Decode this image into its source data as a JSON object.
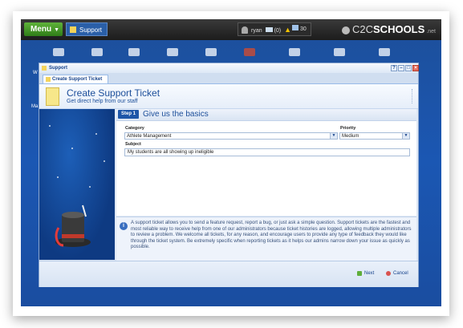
{
  "topbar": {
    "menu_label": "Menu",
    "support_label": "Support",
    "user_name": "ryan",
    "messages_count": "(0)",
    "alerts_count": "30",
    "logo_prefix": "C2C",
    "logo_main": "SCHOOLS",
    "logo_suffix": ".net"
  },
  "desktop": {
    "label_w": "W",
    "label_ma": "Ma"
  },
  "window": {
    "title": "Support",
    "tab_label": "Create Support Ticket",
    "header_title": "Create Support Ticket",
    "header_subtitle": "Get direct help from our staff"
  },
  "step": {
    "badge": "Step 1",
    "title": "Give us the basics"
  },
  "form": {
    "category_label": "Category",
    "category_value": "Athlete Management",
    "priority_label": "Priority",
    "priority_value": "Medium",
    "subject_label": "Subject",
    "subject_value": "My students are all showing up ineligible"
  },
  "info": {
    "text": "A support ticket allows you to send a feature request, report a bug, or just ask a simple question. Support tickets are the fastest and most reliable way to receive help from one of our administrators because ticket histories are logged, allowing multiple administrators to review a problem. We welcome all tickets, for any reason, and encourage users to provide any type of feedback they would like through the ticket system. Be extremely specific when reporting tickets as it helps our admins narrow down your issue as quickly as possible."
  },
  "footer": {
    "next_label": "Next",
    "cancel_label": "Cancel"
  },
  "colors": {
    "accent": "#1d4f9a",
    "menu_green": "#3f9a23",
    "desktop_blue": "#1b57b3"
  }
}
